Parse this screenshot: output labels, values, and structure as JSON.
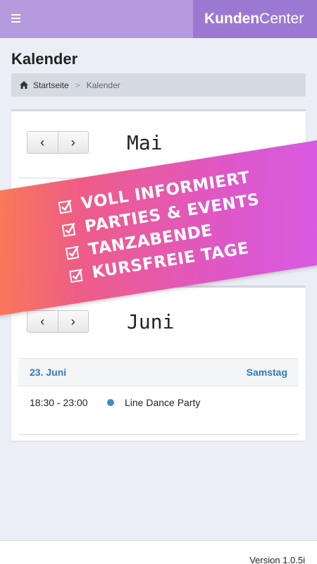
{
  "header": {
    "brand_bold": "Kunden",
    "brand_light": "Center"
  },
  "page": {
    "title": "Kalender"
  },
  "breadcrumb": {
    "home_label": "Startseite",
    "separator": ">",
    "current_label": "Kalender"
  },
  "calendar": [
    {
      "month": "Mai",
      "prev_glyph": "‹",
      "next_glyph": "›"
    },
    {
      "month": "Juni",
      "prev_glyph": "‹",
      "next_glyph": "›",
      "days": [
        {
          "date": "23. Juni",
          "weekday": "Samstag",
          "events": [
            {
              "time": "18:30 - 23:00",
              "title": "Line Dance Party",
              "dot_color": "#3b8fbe"
            }
          ]
        }
      ]
    }
  ],
  "promo_banner": {
    "items": [
      "VOLL INFORMIERT",
      "PARTIES & EVENTS",
      "TANZABENDE",
      "KURSFREIE TAGE"
    ]
  },
  "footer": {
    "version": "Version 1.0.5i"
  },
  "colors": {
    "header_bg": "#b59ade",
    "brand_bg": "#9b79d2",
    "accent_blue": "#2e7bbf",
    "banner_gradient_start": "#ff8a3a",
    "banner_gradient_end": "#d45df0"
  }
}
